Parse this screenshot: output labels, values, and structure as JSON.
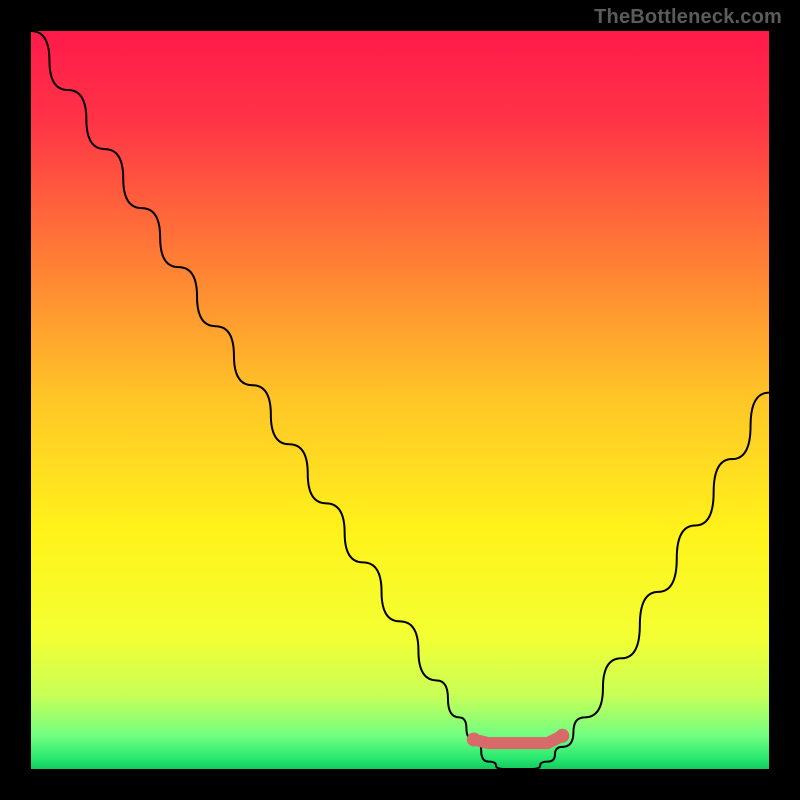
{
  "attribution": "TheBottleneck.com",
  "chart_data": {
    "type": "line",
    "title": "",
    "xlabel": "",
    "ylabel": "",
    "x_range": [
      0,
      100
    ],
    "y_range": [
      0,
      100
    ],
    "series": [
      {
        "name": "bottleneck-curve",
        "x": [
          0,
          5,
          10,
          15,
          20,
          25,
          30,
          35,
          40,
          45,
          50,
          55,
          58,
          60,
          62,
          64,
          66,
          68,
          70,
          72,
          75,
          80,
          85,
          90,
          95,
          100
        ],
        "y": [
          100,
          92,
          84,
          76,
          68,
          60,
          52,
          44,
          36,
          28,
          20,
          12,
          7,
          4,
          1,
          0,
          0,
          0,
          1,
          3,
          7,
          15,
          24,
          33,
          42,
          51
        ]
      },
      {
        "name": "optimal-zone-marker",
        "x": [
          60,
          62,
          64,
          66,
          68,
          70,
          72
        ],
        "y": [
          4,
          3.5,
          3.5,
          3.5,
          3.5,
          3.5,
          4.5
        ]
      }
    ],
    "gradient_stops": [
      {
        "offset": 0.0,
        "color": "#ff1a4a"
      },
      {
        "offset": 0.12,
        "color": "#ff3347"
      },
      {
        "offset": 0.3,
        "color": "#ff7a36"
      },
      {
        "offset": 0.5,
        "color": "#ffc627"
      },
      {
        "offset": 0.68,
        "color": "#fff31b"
      },
      {
        "offset": 0.82,
        "color": "#f3ff33"
      },
      {
        "offset": 0.9,
        "color": "#c8ff57"
      },
      {
        "offset": 0.955,
        "color": "#72ff82"
      },
      {
        "offset": 0.985,
        "color": "#29e86f"
      },
      {
        "offset": 1.0,
        "color": "#13c95e"
      }
    ],
    "marker_style": {
      "color": "#d86a6a",
      "endpoint_radius_px": 7,
      "stroke_width_px": 12
    },
    "curve_style": {
      "color": "#000000",
      "stroke_width_px": 2
    }
  }
}
